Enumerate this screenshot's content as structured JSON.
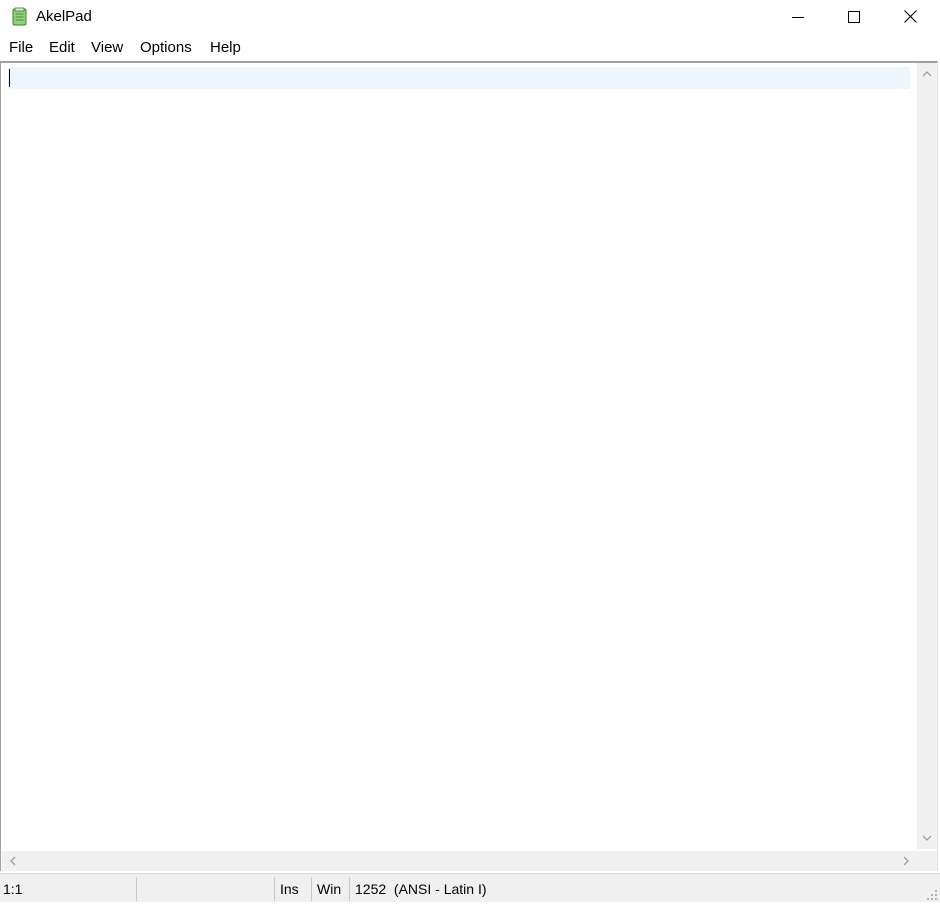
{
  "window": {
    "title": "AkelPad",
    "icon": "notepad-app-icon",
    "controls": {
      "minimize": "minimize-icon",
      "maximize": "maximize-icon",
      "close": "close-icon"
    }
  },
  "menu": {
    "items": [
      "File",
      "Edit",
      "View",
      "Options",
      "Help"
    ]
  },
  "editor": {
    "content": "",
    "current_line_color": "#eef4fb"
  },
  "statusbar": {
    "position": "1:1",
    "modified": "",
    "insert_mode": "Ins",
    "newline": "Win",
    "codepage": "1252  (ANSI - Latin I)"
  }
}
